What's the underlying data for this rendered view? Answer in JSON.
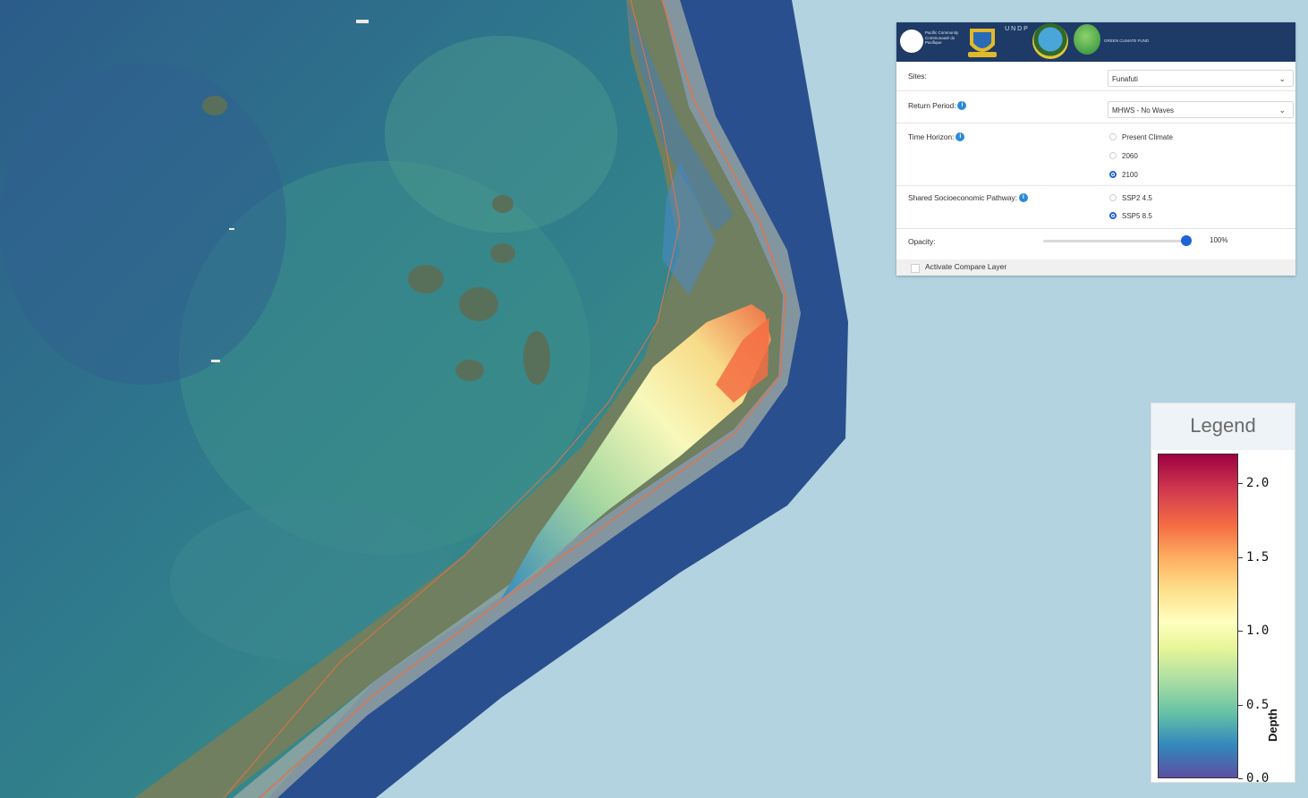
{
  "header": {
    "org_text": "Pacific Community Communauté du Pacifique",
    "undp_text": "U N D P",
    "gcf_text": "GREEN CLIMATE FUND"
  },
  "controls": {
    "sites_label": "Sites:",
    "sites_value": "Funafuti",
    "return_label": "Return Period:",
    "return_value": "MHWS - No Waves",
    "time_label": "Time Horizon:",
    "time_options": [
      "Present Climate",
      "2060",
      "2100"
    ],
    "time_selected": "2100",
    "ssp_label": "Shared Socioeconomic Pathway:",
    "ssp_options": [
      "SSP2 4.5",
      "SSP5 8.5"
    ],
    "ssp_selected": "SSP5 8.5",
    "opacity_label": "Opacity:",
    "opacity_value": "100%",
    "compare_label": "Activate Compare Layer"
  },
  "legend": {
    "title": "Legend",
    "ticks": [
      "2.0",
      "1.5",
      "1.0",
      "0.5",
      "0.0"
    ],
    "label": "Depth",
    "range": [
      0.0,
      2.2
    ]
  },
  "colors": {
    "header_bg": "#1e3a66",
    "accent": "#1e63d6",
    "ocean": "#b3d3e0"
  }
}
